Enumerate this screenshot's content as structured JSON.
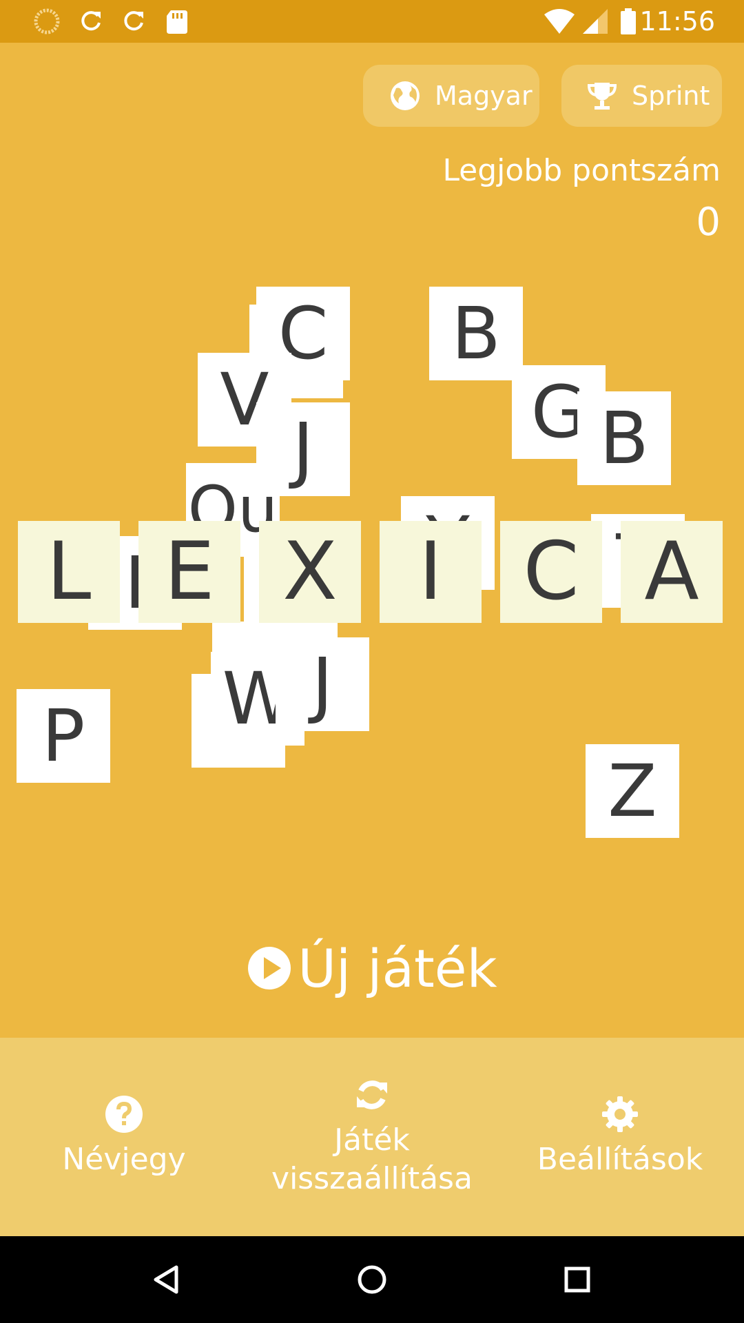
{
  "status_bar": {
    "time": "11:56",
    "icons": [
      "loading-icon",
      "refresh-icon",
      "refresh-icon",
      "sd-card-icon",
      "wifi-icon",
      "signal-icon",
      "battery-icon"
    ]
  },
  "top_buttons": {
    "language": {
      "label": "Magyar",
      "icon": "globe-icon"
    },
    "mode": {
      "label": "Sprint",
      "icon": "trophy-icon"
    }
  },
  "best_score": {
    "label": "Legjobb pontszám",
    "value": "0"
  },
  "title_tiles": [
    "L",
    "E",
    "X",
    "I",
    "C",
    "A"
  ],
  "scattered_tiles": [
    "C",
    "B",
    "V",
    "G",
    "B",
    "J",
    "Qu",
    "Y",
    "T",
    "I",
    "W",
    "J",
    "P",
    "Z"
  ],
  "new_game": {
    "label": "Új játék",
    "icon": "play-circle-icon"
  },
  "bottom_nav": [
    {
      "label": "Névjegy",
      "icon": "help-icon"
    },
    {
      "label": "Játék visszaállítása",
      "icon": "refresh-icon"
    },
    {
      "label": "Beállítások",
      "icon": "gear-icon"
    }
  ],
  "colors": {
    "background": "#EDB841",
    "status_bar": "#DB9A12",
    "bottom_bar": "#EFCC6D",
    "tile": "#FFFFFF",
    "title_tile": "#F7F7DA",
    "tile_text": "#3A3A3A"
  }
}
